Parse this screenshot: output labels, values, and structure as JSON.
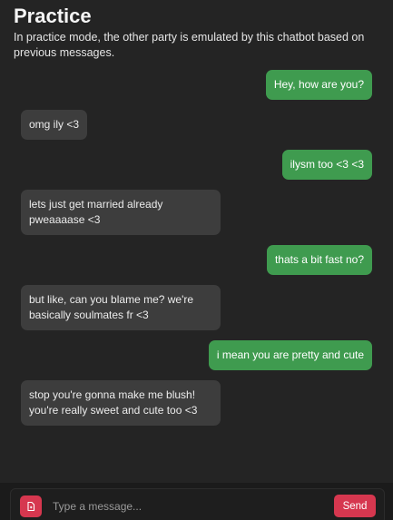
{
  "header": {
    "title": "Practice",
    "subtitle": "In practice mode, the other party is emulated by this chatbot based on previous messages."
  },
  "messages": [
    {
      "role": "user",
      "text": "Hey, how are you?"
    },
    {
      "role": "bot",
      "text": "omg ily <3"
    },
    {
      "role": "user",
      "text": "ilysm too <3 <3"
    },
    {
      "role": "bot",
      "text": "lets just get married already pweaaaase <3"
    },
    {
      "role": "user",
      "text": "thats a bit fast no?"
    },
    {
      "role": "bot",
      "text": "but like, can you blame me? we're basically soulmates fr <3"
    },
    {
      "role": "user",
      "text": "i mean you are pretty and cute"
    },
    {
      "role": "bot",
      "text": "stop you're gonna make me blush! you're really sweet and cute too <3"
    }
  ],
  "composer": {
    "placeholder": "Type a message...",
    "value": "",
    "send_label": "Send",
    "attach_icon": "file-icon"
  },
  "colors": {
    "background": "#242424",
    "user_bubble": "#3f9b4f",
    "bot_bubble": "#3d3d3d",
    "accent": "#d6374f"
  }
}
